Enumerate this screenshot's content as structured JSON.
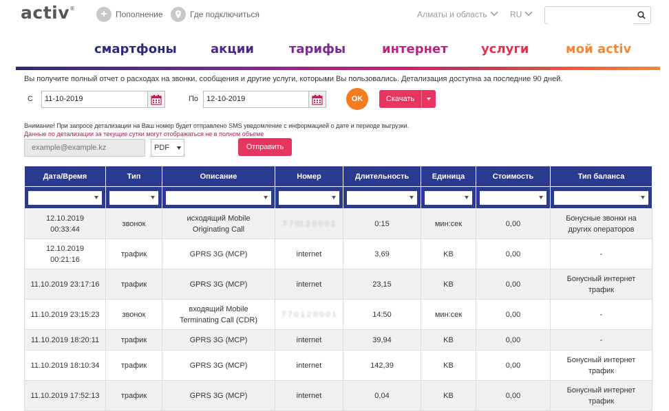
{
  "header": {
    "logo": "activ",
    "logo_mark": "®",
    "topup": "Пополнение",
    "where": "Где подключиться",
    "region": "Алматы и область",
    "lang": "RU",
    "search_placeholder": ""
  },
  "nav": [
    {
      "label": "смартфоны",
      "color": "#2d2a7a"
    },
    {
      "label": "акции",
      "color": "#4a2a86"
    },
    {
      "label": "тарифы",
      "color": "#7a2a8c"
    },
    {
      "label": "интернет",
      "color": "#b8247e"
    },
    {
      "label": "услуги",
      "color": "#e0324f"
    },
    {
      "label": "мой activ",
      "color": "#f08a3a"
    }
  ],
  "info_text": "Вы получите полный отчет о расходах на звонки, сообщения и другие услуги, которыми Вы пользовались. Детализация доступна за последние 90 дней.",
  "filter": {
    "from_label": "С",
    "from_value": "11-10-2019",
    "to_label": "По",
    "to_value": "12-10-2019",
    "ok_label": "OK",
    "download_label": "Скачать"
  },
  "warning1": "Внимание! При запросе детализации на Ваш номер будет отправлено SMS уведомление с информацией о дате и периоде выгрузки.",
  "warning2": "Данные по детализации за текущие сутки могут отображаться не в полном объеме",
  "email_placeholder": "example@example.kz",
  "format_value": "PDF",
  "send_label": "Отправить",
  "table": {
    "headers": [
      "Дата/Время",
      "Тип",
      "Описание",
      "Номер",
      "Длительность",
      "Единица",
      "Стоимость",
      "Тип баланса"
    ],
    "rows": [
      {
        "date": "12.10.2019",
        "time": "00:33:44",
        "type": "звонок",
        "desc1": "исходящий Mobile",
        "desc2": "Originating Call",
        "number": "7 7 01 2 0 0 0 1",
        "duration": "0:15",
        "unit": "мин:сек",
        "cost": "0,00",
        "bal1": "Бонусные звонки на",
        "bal2": "других операторов"
      },
      {
        "date": "12.10.2019",
        "time": "00:21:16",
        "type": "трафик",
        "desc1": "GPRS 3G (MCP)",
        "desc2": "",
        "number": "internet",
        "duration": "3,69",
        "unit": "KB",
        "cost": "0,00",
        "bal1": "-",
        "bal2": ""
      },
      {
        "date": "11.10.2019 23:17:16",
        "time": "",
        "type": "трафик",
        "desc1": "GPRS 3G (MCP)",
        "desc2": "",
        "number": "internet",
        "duration": "23,15",
        "unit": "KB",
        "cost": "0,00",
        "bal1": "Бонусный интернет",
        "bal2": "трафик"
      },
      {
        "date": "11.10.2019 23:15:23",
        "time": "",
        "type": "звонок",
        "desc1": "входящий Mobile",
        "desc2": "Terminating Call (CDR)",
        "number": "7 7 0 1 2 0 0 0 1",
        "duration": "14:50",
        "unit": "мин:сек",
        "cost": "0,00",
        "bal1": "-",
        "bal2": ""
      },
      {
        "date": "11.10.2019 18:20:11",
        "time": "",
        "type": "трафик",
        "desc1": "GPRS 3G (MCP)",
        "desc2": "",
        "number": "internet",
        "duration": "39,94",
        "unit": "KB",
        "cost": "0,00",
        "bal1": "-",
        "bal2": ""
      },
      {
        "date": "11.10.2019 18:10:34",
        "time": "",
        "type": "трафик",
        "desc1": "GPRS 3G (MCP)",
        "desc2": "",
        "number": "internet",
        "duration": "142,39",
        "unit": "KB",
        "cost": "0,00",
        "bal1": "Бонусный интернет",
        "bal2": "трафик"
      },
      {
        "date": "11.10.2019 17:52:13",
        "time": "",
        "type": "трафик",
        "desc1": "GPRS 3G (MCP)",
        "desc2": "",
        "number": "internet",
        "duration": "0,04",
        "unit": "KB",
        "cost": "0,00",
        "bal1": "Бонусный интернет",
        "bal2": "трафик"
      }
    ]
  }
}
